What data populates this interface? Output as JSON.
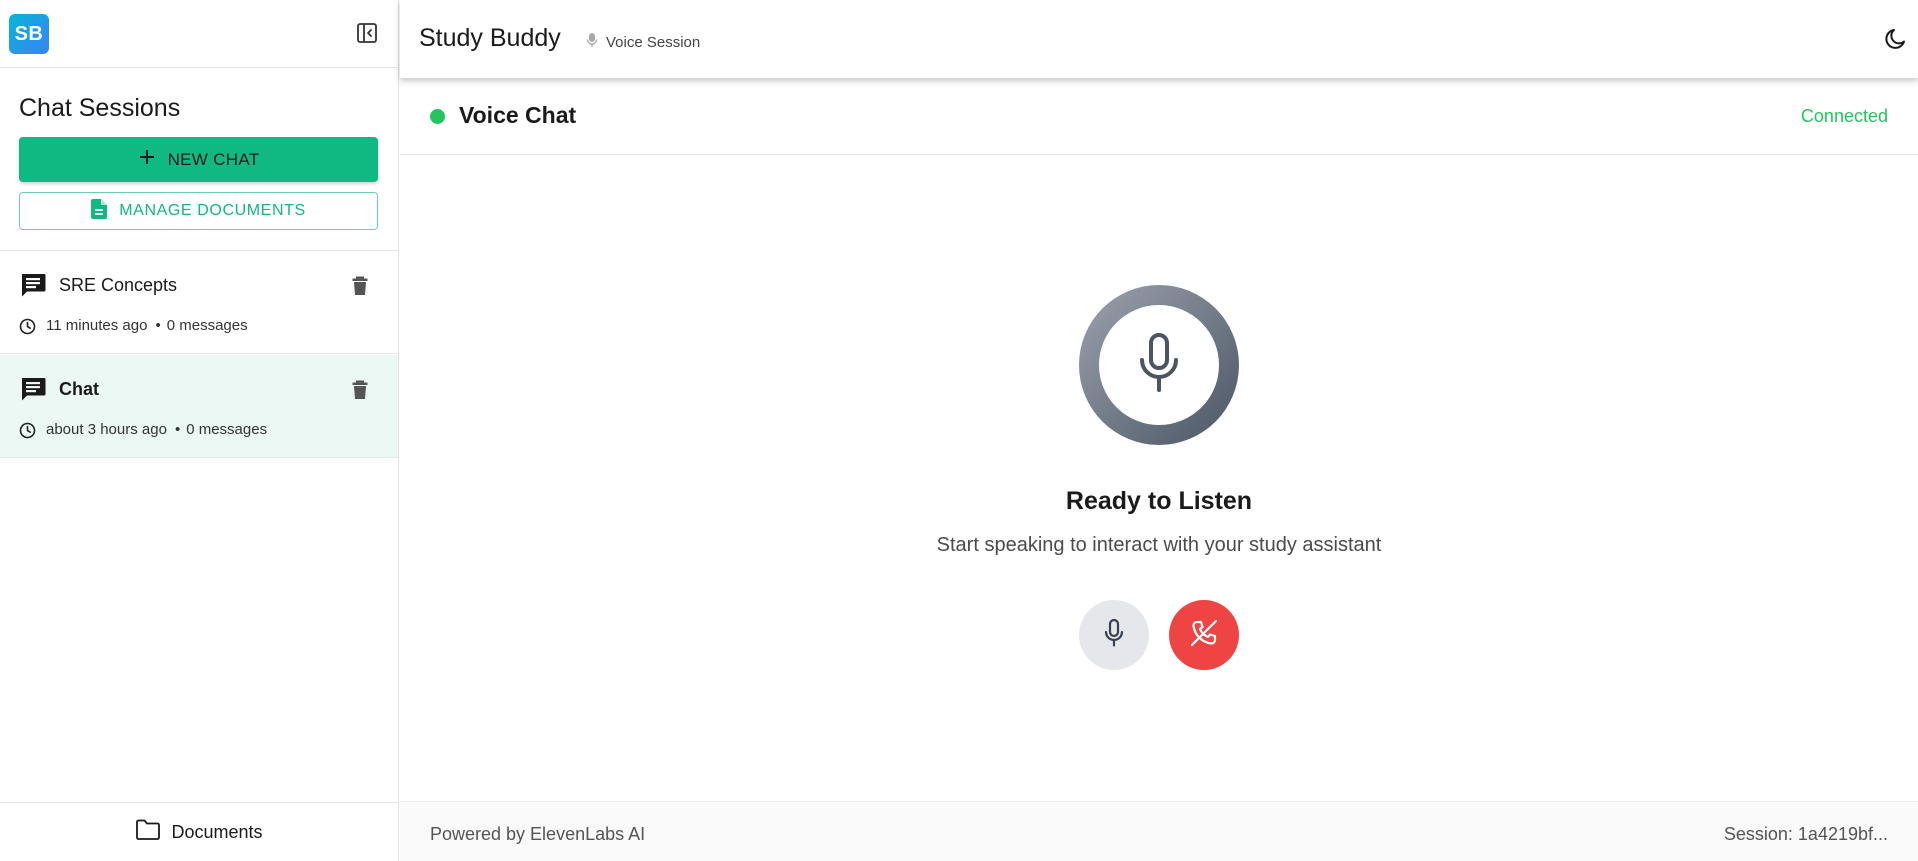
{
  "sidebar": {
    "logo_text": "SB",
    "title": "Chat Sessions",
    "new_chat_label": "NEW CHAT",
    "manage_docs_label": "MANAGE DOCUMENTS",
    "sessions": [
      {
        "name": "SRE Concepts",
        "time": "11 minutes ago",
        "count": "0 messages",
        "selected": false
      },
      {
        "name": "Chat",
        "time": "about 3 hours ago",
        "count": "0 messages",
        "selected": true
      }
    ],
    "footer_label": "Documents"
  },
  "header": {
    "title": "Study Buddy",
    "session_chip": "Voice Session"
  },
  "voice": {
    "title": "Voice Chat",
    "status": "Connected",
    "ready_text": "Ready to Listen",
    "sub_text": "Start speaking to interact with your study assistant"
  },
  "footer": {
    "powered_by": "Powered by ElevenLabs AI",
    "session_id": "Session: 1a4219bf..."
  },
  "colors": {
    "accent": "#10b981",
    "status_green": "#22c55e",
    "end_call": "#ef4444",
    "selected_row": "#ecf8f4"
  },
  "icons": [
    "sidebar-collapse-icon",
    "plus-icon",
    "document-icon",
    "chat-icon",
    "trash-icon",
    "clock-icon",
    "folder-icon",
    "mic-icon",
    "moon-icon",
    "phone-off-icon"
  ]
}
